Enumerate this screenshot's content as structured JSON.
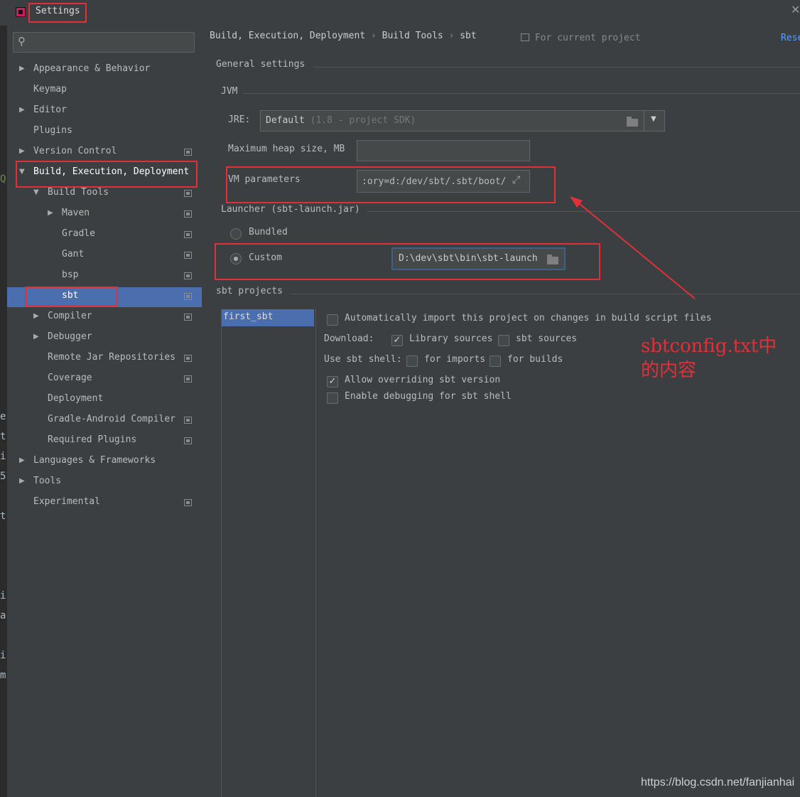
{
  "window": {
    "title": "Settings"
  },
  "editor_gutter": [
    "Q",
    "e",
    "t",
    "i",
    "5",
    "t",
    "i",
    "a",
    "i",
    "m"
  ],
  "search": {
    "placeholder": ""
  },
  "sidebar": {
    "items": [
      {
        "label": "Appearance & Behavior",
        "arrow": "▶",
        "project": false
      },
      {
        "label": "Keymap",
        "arrow": "",
        "project": false
      },
      {
        "label": "Editor",
        "arrow": "▶",
        "project": false
      },
      {
        "label": "Plugins",
        "arrow": "",
        "project": false
      },
      {
        "label": "Version Control",
        "arrow": "▶",
        "project": true
      },
      {
        "label": "Build, Execution, Deployment",
        "arrow": "▼",
        "project": false
      },
      {
        "label": "Build Tools",
        "arrow": "▼",
        "project": true
      },
      {
        "label": "Maven",
        "arrow": "▶",
        "project": true
      },
      {
        "label": "Gradle",
        "arrow": "",
        "project": true
      },
      {
        "label": "Gant",
        "arrow": "",
        "project": true
      },
      {
        "label": "bsp",
        "arrow": "",
        "project": true
      },
      {
        "label": "sbt",
        "arrow": "",
        "project": true
      },
      {
        "label": "Compiler",
        "arrow": "▶",
        "project": true
      },
      {
        "label": "Debugger",
        "arrow": "▶",
        "project": false
      },
      {
        "label": "Remote Jar Repositories",
        "arrow": "",
        "project": true
      },
      {
        "label": "Coverage",
        "arrow": "",
        "project": true
      },
      {
        "label": "Deployment",
        "arrow": "",
        "project": false
      },
      {
        "label": "Gradle-Android Compiler",
        "arrow": "",
        "project": true
      },
      {
        "label": "Required Plugins",
        "arrow": "",
        "project": true
      },
      {
        "label": "Languages & Frameworks",
        "arrow": "▶",
        "project": false
      },
      {
        "label": "Tools",
        "arrow": "▶",
        "project": false
      },
      {
        "label": "Experimental",
        "arrow": "",
        "project": true
      }
    ]
  },
  "breadcrumb": {
    "part1": "Build, Execution, Deployment",
    "part2": "Build Tools",
    "part3": "sbt",
    "sep": "›"
  },
  "header": {
    "scope": "For current project",
    "reset": "Rese"
  },
  "general": {
    "section": "General settings",
    "jvm": "JVM",
    "jre_label": "JRE:",
    "jre_value": "Default",
    "jre_hint": "(1.8 - project SDK)",
    "heap_label": "Maximum heap size, MB",
    "heap_value": "",
    "vm_label": "VM parameters",
    "vm_value": ":ory=d:/dev/sbt/.sbt/boot/"
  },
  "launcher": {
    "section": "Launcher (sbt-launch.jar)",
    "bundled_label": "Bundled",
    "custom_label": "Custom",
    "custom_value": "D:\\dev\\sbt\\bin\\sbt-launch",
    "selected": "custom"
  },
  "projects": {
    "section": "sbt projects",
    "items": [
      "first_sbt"
    ],
    "auto_import": {
      "label": "Automatically import this project on changes in build script files",
      "checked": false
    },
    "download_label": "Download:",
    "library_sources": {
      "label": "Library sources",
      "checked": true
    },
    "sbt_sources": {
      "label": "sbt sources",
      "checked": false
    },
    "shell_label": "Use sbt shell:",
    "for_imports": {
      "label": "for imports",
      "checked": false
    },
    "for_builds": {
      "label": "for builds",
      "checked": false
    },
    "allow_override": {
      "label": "Allow overriding sbt version",
      "checked": true
    },
    "enable_debug": {
      "label": "Enable debugging for sbt shell",
      "checked": false
    }
  },
  "annotation": {
    "line1": "sbtconfig.txt中",
    "line2": "的内容"
  },
  "watermark": "https://blog.csdn.net/fanjianhai",
  "colors": {
    "selection": "#4b6eaf",
    "annotation": "#e0303a",
    "link": "#589df6",
    "background": "#3c3f41"
  }
}
